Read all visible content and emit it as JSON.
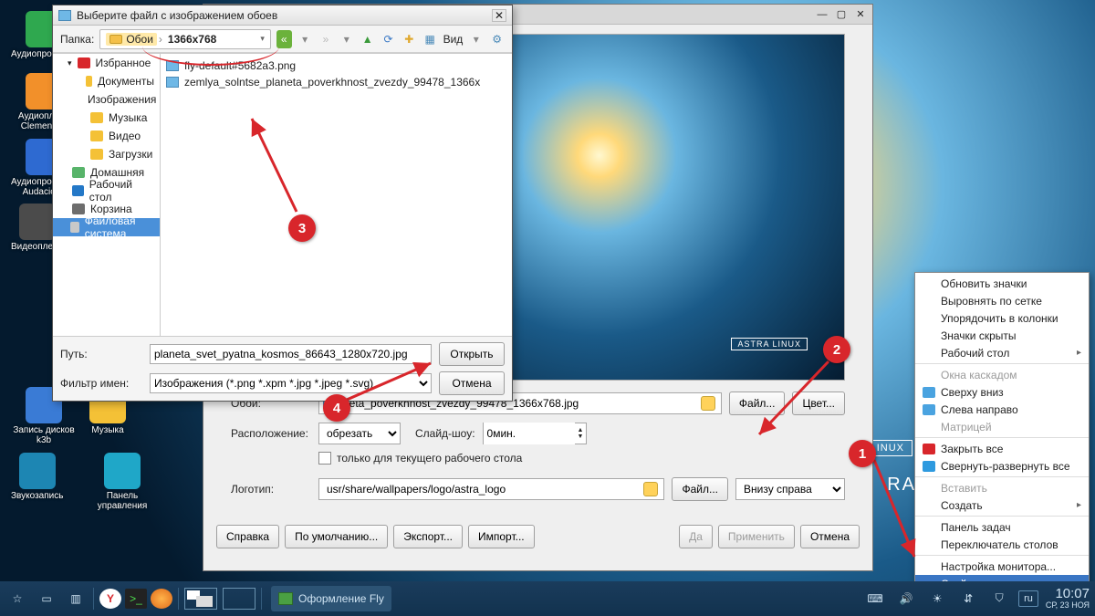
{
  "desktop": {
    "icons": [
      {
        "label": "Аудиопроигрыватель",
        "color": "#2fa84f"
      },
      {
        "label": "Аудиоплеер Clementine",
        "color": "#f2902a"
      },
      {
        "label": "Аудиопроигрыватель Audacious",
        "color": "#2e6ad1"
      },
      {
        "label": "Видеоплеер",
        "color": "#4b4b4b"
      },
      {
        "label": "Запись дисков k3b",
        "color": "#3a7bd5"
      },
      {
        "label": "Музыка",
        "color": "#f4c136"
      },
      {
        "label": "Звукозапись",
        "color": "#1d86b3"
      },
      {
        "label": "Панель управления",
        "color": "#1fa7c8"
      }
    ],
    "watermark": "ASTRA LINUX"
  },
  "taskbar": {
    "task_label": "Оформление Fly",
    "lang": "ru",
    "time": "10:07",
    "date": "СР, 23 НОЯ"
  },
  "settings": {
    "wallpaper_label": "Обои:",
    "wallpaper_value": "neta_poverkhnost_zvezdy_99478_1366x768.jpg",
    "file_btn": "Файл...",
    "color_btn": "Цвет...",
    "layout_label": "Расположение:",
    "layout_value": "обрезать",
    "slideshow_label": "Слайд-шоу:",
    "slideshow_value": "0мин.",
    "checkbox": "только для текущего рабочего стола",
    "logo_label": "Логотип:",
    "logo_value": "usr/share/wallpapers/logo/astra_logo",
    "logo_file_btn": "Файл...",
    "logo_pos_value": "Внизу справа",
    "help_btn": "Справка",
    "default_btn": "По умолчанию...",
    "export_btn": "Экспорт...",
    "import_btn": "Импорт...",
    "ok_btn": "Да",
    "apply_btn": "Применить",
    "cancel_btn": "Отмена",
    "prev_watermark": "ASTRA LINUX"
  },
  "chooser": {
    "title": "Выберите файл с изображением обоев",
    "folder_label": "Папка:",
    "bc1": "Обои",
    "bc2": "1366x768",
    "view_label": "Вид",
    "places": [
      {
        "label": "Избранное",
        "color": "#d8262b",
        "indent": 1,
        "exp": true
      },
      {
        "label": "Документы",
        "color": "#f4c136",
        "indent": 2
      },
      {
        "label": "Изображения",
        "color": "#f4c136",
        "indent": 2
      },
      {
        "label": "Музыка",
        "color": "#f4c136",
        "indent": 2
      },
      {
        "label": "Видео",
        "color": "#f4c136",
        "indent": 2
      },
      {
        "label": "Загрузки",
        "color": "#f4c136",
        "indent": 2
      },
      {
        "label": "Домашняя",
        "color": "#58b46a",
        "indent": 0
      },
      {
        "label": "Рабочий стол",
        "color": "#2478c7",
        "indent": 0
      },
      {
        "label": "Корзина",
        "color": "#6d6d6d",
        "indent": 0
      },
      {
        "label": "Файловая система",
        "color": "#c8c8c8",
        "indent": 0,
        "sel": true
      }
    ],
    "files": [
      "fly-default#5682a3.png",
      "zemlya_solntse_planeta_poverkhnost_zvezdy_99478_1366x"
    ],
    "path_label": "Путь:",
    "path_value": "planeta_svet_pyatna_kosmos_86643_1280x720.jpg",
    "filter_label": "Фильтр имен:",
    "filter_value": "Изображения (*.png *.xpm *.jpg *.jpeg *.svg)",
    "open_btn": "Открыть",
    "cancel_btn": "Отмена"
  },
  "context_menu": {
    "items": [
      {
        "label": "Обновить значки"
      },
      {
        "label": "Выровнять по сетке"
      },
      {
        "label": "Упорядочить в колонки"
      },
      {
        "label": "Значки скрыты"
      },
      {
        "label": "Рабочий стол",
        "arrow": true
      },
      {
        "sep": true
      },
      {
        "label": "Окна каскадом",
        "dis": true
      },
      {
        "label": "Сверху вниз",
        "icon": "#4aa3e0"
      },
      {
        "label": "Слева направо",
        "icon": "#4aa3e0"
      },
      {
        "label": "Матрицей",
        "dis": true
      },
      {
        "sep": true
      },
      {
        "label": "Закрыть все",
        "icon": "#d8262b"
      },
      {
        "label": "Свернуть-развернуть все",
        "icon": "#2e9adf"
      },
      {
        "sep": true
      },
      {
        "label": "Вставить",
        "dis": true
      },
      {
        "label": "Создать",
        "arrow": true
      },
      {
        "sep": true
      },
      {
        "label": "Панель задач"
      },
      {
        "label": "Переключатель столов"
      },
      {
        "sep": true
      },
      {
        "label": "Настройка монитора..."
      },
      {
        "label": "Свойства...",
        "hl": true
      }
    ]
  }
}
